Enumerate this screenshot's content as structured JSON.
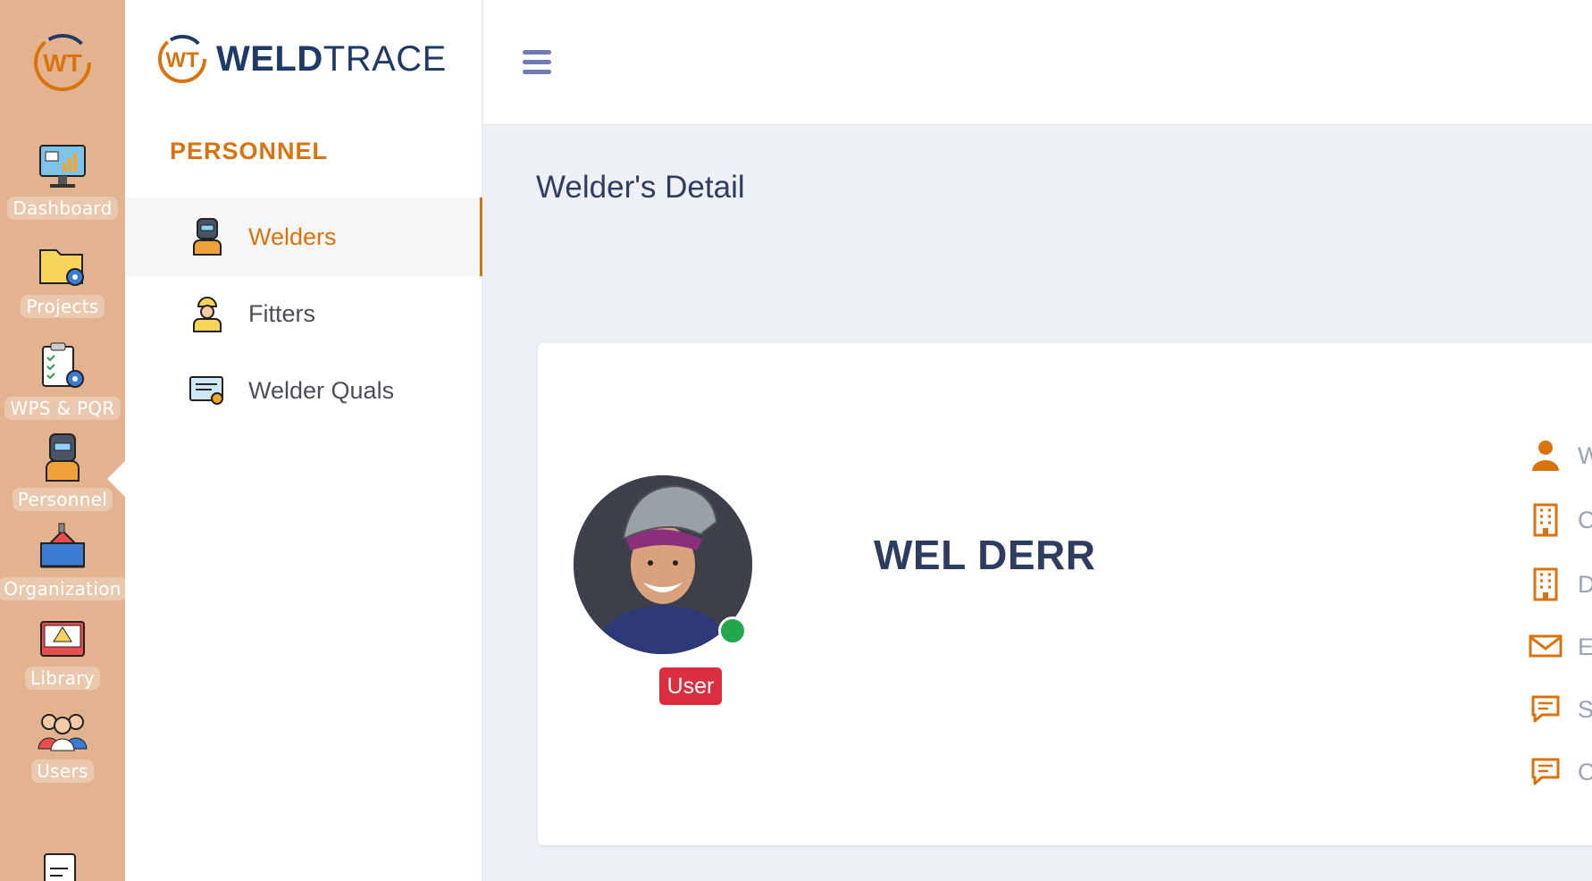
{
  "rail": {
    "items": [
      {
        "label": "Dashboard",
        "icon": "dashboard-monitor-icon"
      },
      {
        "label": "Projects",
        "icon": "projects-folder-icon"
      },
      {
        "label": "WPS & PQR",
        "icon": "wps-pqr-clipboard-icon"
      },
      {
        "label": "Personnel",
        "icon": "personnel-welder-icon"
      },
      {
        "label": "Organization",
        "icon": "organization-factory-icon"
      },
      {
        "label": "Library",
        "icon": "library-book-icon"
      },
      {
        "label": "Users",
        "icon": "users-group-icon"
      }
    ]
  },
  "brand": {
    "bold": "WELD",
    "light": "TRACE",
    "logo_letters": "WT"
  },
  "subnav": {
    "section_title": "PERSONNEL",
    "items": [
      {
        "label": "Welders",
        "icon": "welder-icon",
        "active": true
      },
      {
        "label": "Fitters",
        "icon": "fitter-icon",
        "active": false
      },
      {
        "label": "Welder Quals",
        "icon": "certificate-icon",
        "active": false
      }
    ]
  },
  "page": {
    "title": "Welder's Detail"
  },
  "profile": {
    "name": "WEL DERR",
    "role": "User",
    "status": "online",
    "info_rows": [
      {
        "icon": "user-icon",
        "text": "W"
      },
      {
        "icon": "building-icon",
        "text": "C"
      },
      {
        "icon": "building-icon",
        "text": "D"
      },
      {
        "icon": "mail-icon",
        "text": "E"
      },
      {
        "icon": "message-icon",
        "text": "S"
      },
      {
        "icon": "message-icon",
        "text": "C"
      }
    ]
  },
  "colors": {
    "rail_bg": "#e2b38e",
    "accent": "#d9730d",
    "title": "#2e3d5f",
    "badge": "#dc2e41",
    "online": "#22a84b"
  }
}
